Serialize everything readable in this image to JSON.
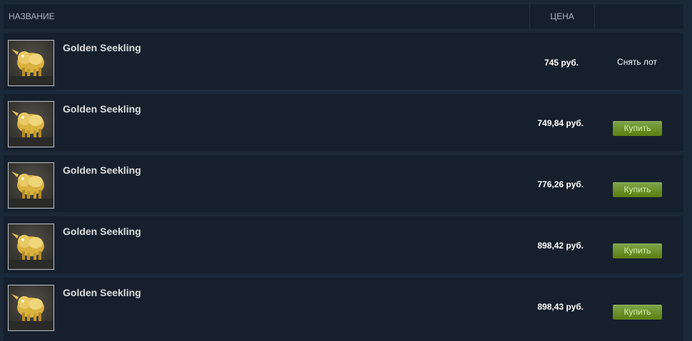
{
  "table": {
    "header_name": "НАЗВАНИЕ",
    "header_price": "ЦЕНА"
  },
  "listings": [
    {
      "item_name": "Golden Seekling",
      "price": "745 руб.",
      "action": "Снять лот",
      "action_type": "remove"
    },
    {
      "item_name": "Golden Seekling",
      "price": "749,84 руб.",
      "action": "Купить",
      "action_type": "buy"
    },
    {
      "item_name": "Golden Seekling",
      "price": "776,26 руб.",
      "action": "Купить",
      "action_type": "buy"
    },
    {
      "item_name": "Golden Seekling",
      "price": "898,42 руб.",
      "action": "Купить",
      "action_type": "buy"
    },
    {
      "item_name": "Golden Seekling",
      "price": "898,43 руб.",
      "action": "Купить",
      "action_type": "buy"
    }
  ],
  "item_icon": "golden-seekling-icon",
  "colors": {
    "background": "#1b2838",
    "row": "#16202d",
    "buy_button": "#5c7e10",
    "buy_text": "#d2efa9"
  }
}
